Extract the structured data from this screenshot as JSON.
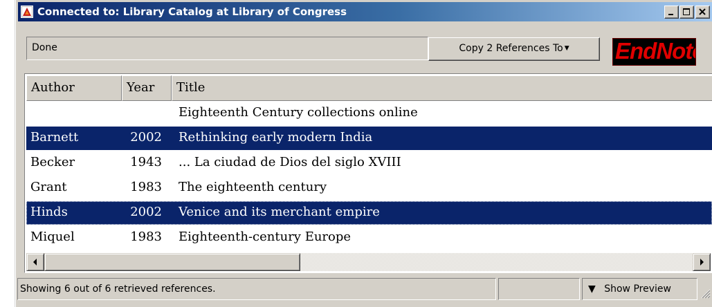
{
  "window": {
    "title": "Connected to: Library Catalog at Library of Congress",
    "title_bar_color": "#0a246a"
  },
  "toolbar": {
    "status_text": "Done",
    "copy_button_label": "Copy 2 References To",
    "copy_button_icon": "chevron-down-icon",
    "logo_text": "EndNote",
    "logo_color": "#e00000"
  },
  "table": {
    "columns": [
      "Author",
      "Year",
      "Title"
    ],
    "selection_color": "#0a246a",
    "rows": [
      {
        "author": "",
        "year": "",
        "title": "Eighteenth Century collections online",
        "selected": false
      },
      {
        "author": "Barnett",
        "year": "2002",
        "title": "Rethinking early modern India",
        "selected": true
      },
      {
        "author": "Becker",
        "year": "1943",
        "title": "... La ciudad de Dios del siglo XVIII",
        "selected": false
      },
      {
        "author": "Grant",
        "year": "1983",
        "title": "The eighteenth century",
        "selected": false
      },
      {
        "author": "Hinds",
        "year": "2002",
        "title": "Venice and its merchant empire",
        "selected": true
      },
      {
        "author": "Miquel",
        "year": "1983",
        "title": "Eighteenth-century Europe",
        "selected": false
      }
    ]
  },
  "statusbar": {
    "message": "Showing 6 out of 6 retrieved references.",
    "preview_label": "Show Preview",
    "preview_icon": "double-chevron-down-icon"
  }
}
